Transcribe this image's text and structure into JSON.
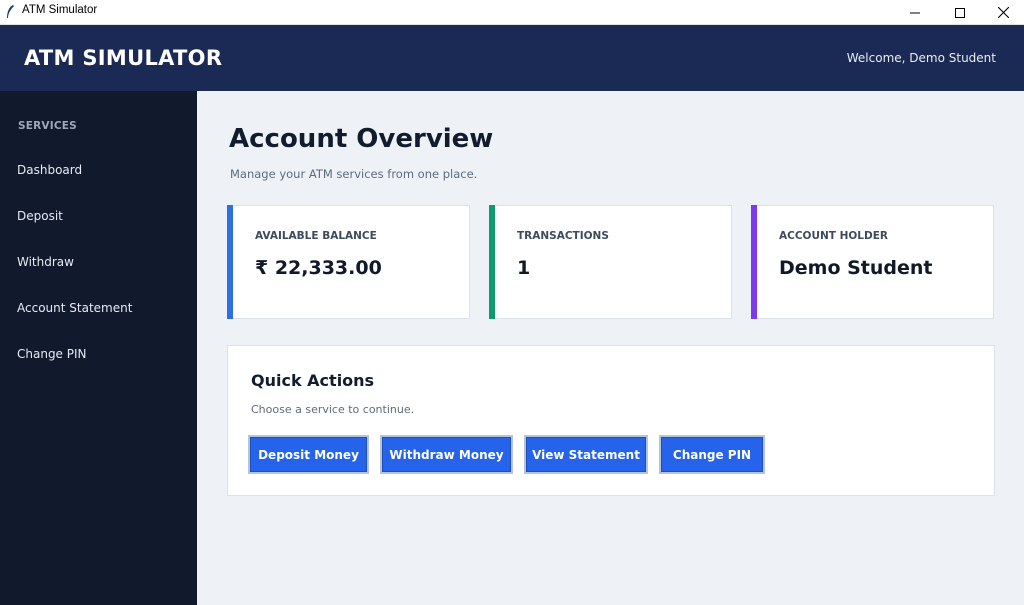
{
  "window": {
    "title": "ATM Simulator"
  },
  "header": {
    "brand": "ATM SIMULATOR",
    "welcome": "Welcome, Demo Student"
  },
  "sidebar": {
    "section_label": "SERVICES",
    "items": [
      {
        "label": "Dashboard"
      },
      {
        "label": "Deposit"
      },
      {
        "label": "Withdraw"
      },
      {
        "label": "Account Statement"
      },
      {
        "label": "Change PIN"
      }
    ]
  },
  "main": {
    "title": "Account Overview",
    "subtitle": "Manage your ATM services from one place.",
    "cards": [
      {
        "label": "AVAILABLE BALANCE",
        "value": "₹ 22,333.00",
        "accent": "#2f6fe4"
      },
      {
        "label": "TRANSACTIONS",
        "value": "1",
        "accent": "#0f9a6e"
      },
      {
        "label": "ACCOUNT HOLDER",
        "value": "Demo Student",
        "accent": "#7c3aed"
      }
    ],
    "quick_actions": {
      "title": "Quick Actions",
      "subtitle": "Choose a service to continue.",
      "buttons": [
        {
          "label": "Deposit Money"
        },
        {
          "label": "Withdraw Money"
        },
        {
          "label": "View Statement"
        },
        {
          "label": "Change PIN"
        }
      ]
    }
  },
  "colors": {
    "header_bg": "#1b2a55",
    "sidebar_bg": "#111a2d",
    "main_bg": "#eef1f5",
    "button_bg": "#2563eb"
  }
}
